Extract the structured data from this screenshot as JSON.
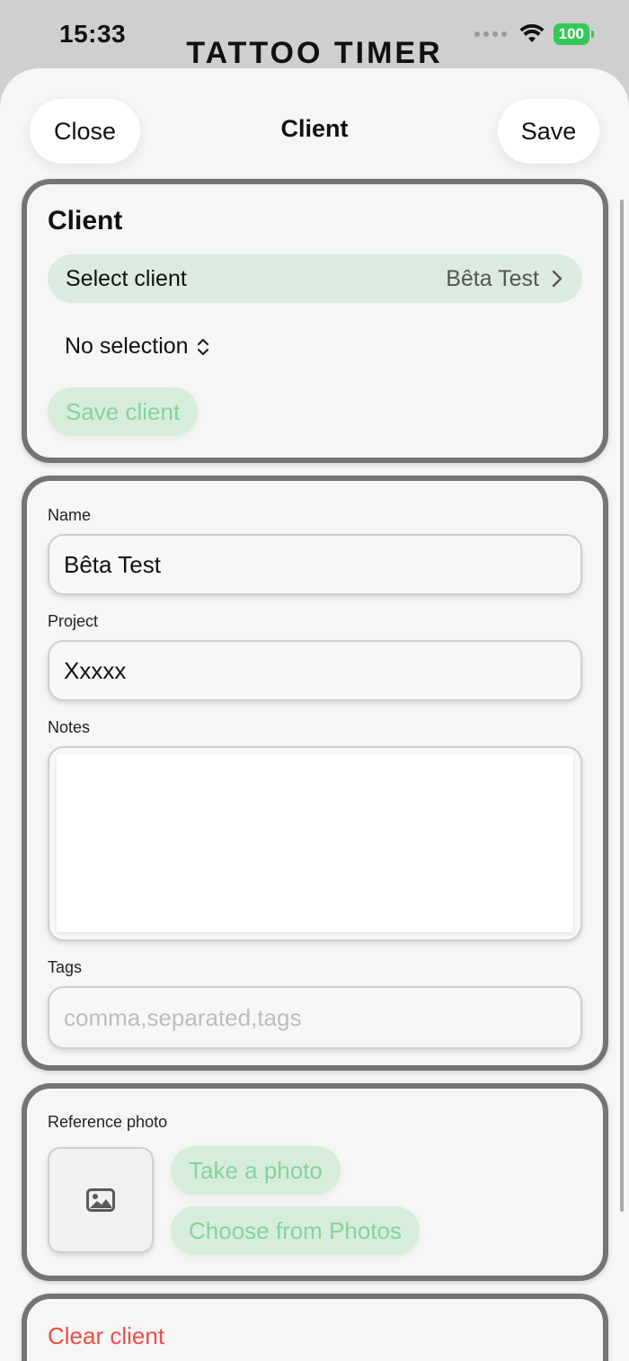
{
  "status_bar": {
    "time": "15:33",
    "battery": "100"
  },
  "background_title": "TATTOO TIMER",
  "nav": {
    "close_label": "Close",
    "title": "Client",
    "save_label": "Save"
  },
  "client_section": {
    "title": "Client",
    "select_label": "Select client",
    "select_value": "Bêta Test",
    "picker_value": "No selection",
    "save_client_label": "Save client"
  },
  "form": {
    "name_label": "Name",
    "name_value": "Bêta Test",
    "project_label": "Project",
    "project_value": "Xxxxx",
    "notes_label": "Notes",
    "notes_value": "",
    "tags_label": "Tags",
    "tags_placeholder": "comma,separated,tags"
  },
  "photo_section": {
    "label": "Reference photo",
    "take_photo_label": "Take a photo",
    "choose_photos_label": "Choose from Photos",
    "placeholder_icon": "photo-icon"
  },
  "clear_client_label": "Clear client",
  "colors": {
    "accent_green_bg": "#d7eddc",
    "accent_green_text": "#86d39a",
    "destructive_red": "#f24b45",
    "battery_green": "#34c759"
  }
}
